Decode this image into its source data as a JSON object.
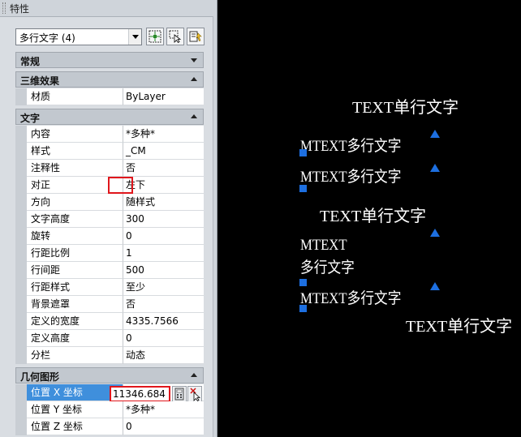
{
  "palette": {
    "title": "特性",
    "selection": "多行文字 (4)",
    "sections": {
      "general": "常规",
      "effects3d": "三维效果",
      "text": "文字",
      "geometry": "几何图形"
    },
    "effects3d_rows": [
      {
        "name": "材质",
        "value": "ByLayer"
      }
    ],
    "text_rows": [
      {
        "name": "内容",
        "value": "*多种*"
      },
      {
        "name": "样式",
        "value": "_CM"
      },
      {
        "name": "注释性",
        "value": "否"
      },
      {
        "name": "对正",
        "value": "左下"
      },
      {
        "name": "方向",
        "value": "随样式"
      },
      {
        "name": "文字高度",
        "value": "300"
      },
      {
        "name": "旋转",
        "value": "0"
      },
      {
        "name": "行距比例",
        "value": "1"
      },
      {
        "name": "行间距",
        "value": "500"
      },
      {
        "name": "行距样式",
        "value": "至少"
      },
      {
        "name": "背景遮罩",
        "value": "否"
      },
      {
        "name": "定义的宽度",
        "value": "4335.7566"
      },
      {
        "name": "定义高度",
        "value": "0"
      },
      {
        "name": "分栏",
        "value": "动态"
      }
    ],
    "geometry_rows": [
      {
        "name": "位置 X 坐标",
        "value": "11346.684"
      },
      {
        "name": "位置 Y 坐标",
        "value": "*多种*"
      },
      {
        "name": "位置 Z 坐标",
        "value": "0"
      }
    ]
  },
  "drawing": {
    "text_single_1": "TEXT单行文字",
    "mtext_1": "MTEXT多行文字",
    "mtext_2": "MTEXT多行文字",
    "text_single_2": "TEXT单行文字",
    "mtext_3_line1": "MTEXT",
    "mtext_3_line2": "多行文字",
    "mtext_4": "MTEXT多行文字",
    "text_single_3": "TEXT单行文字"
  },
  "colors": {
    "grip": "#1d6fe0",
    "highlight": "#e0161c",
    "active_row": "#3f8fdc",
    "canvas": "#000000"
  }
}
